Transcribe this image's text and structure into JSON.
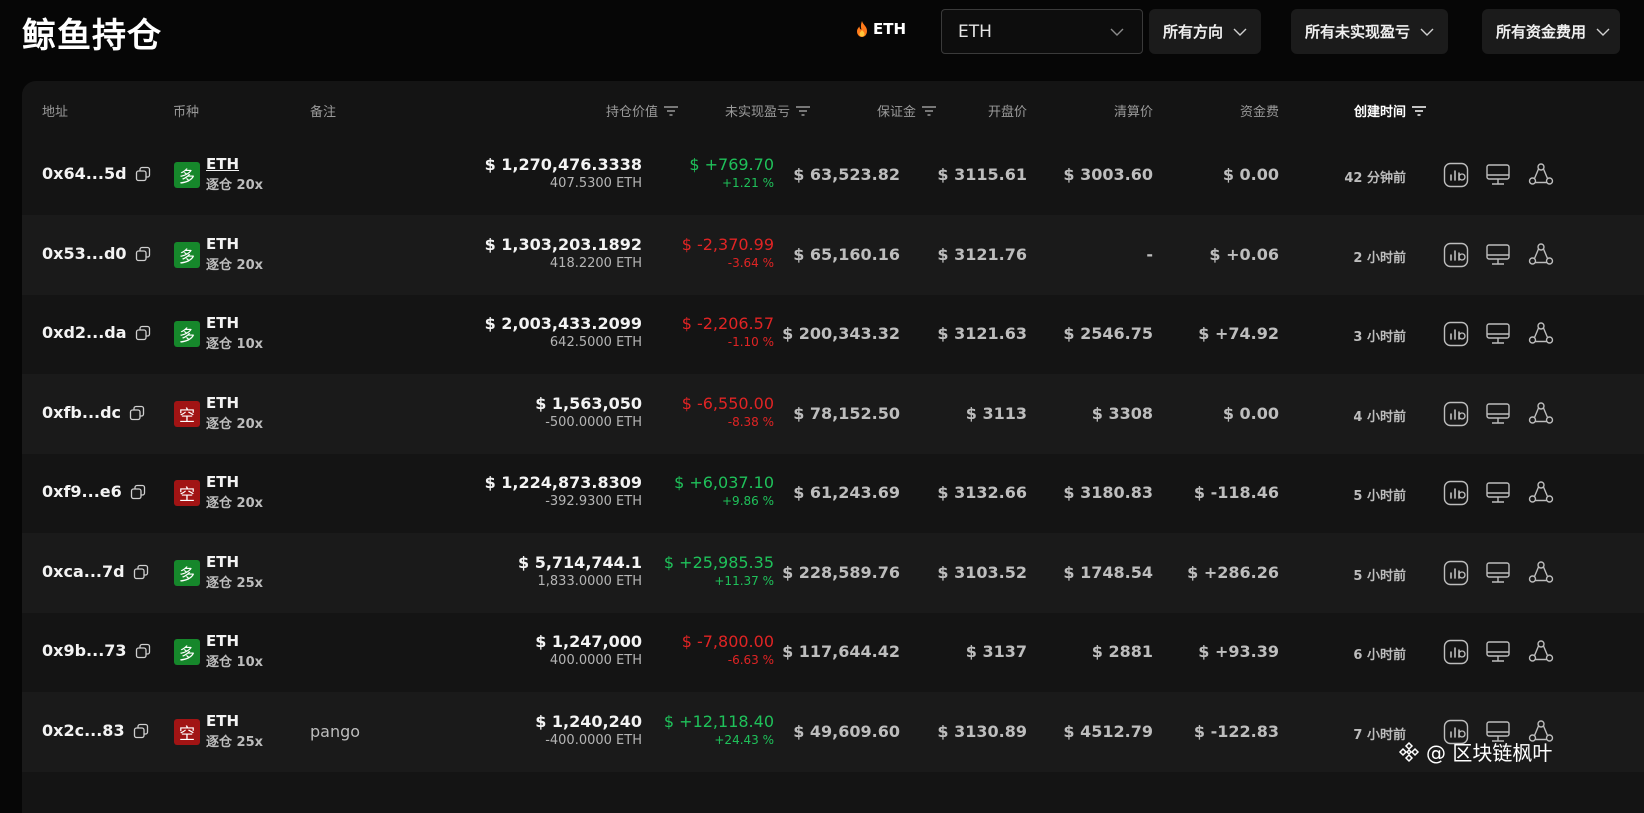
{
  "header": {
    "title": "鲸鱼持仓",
    "coin_tag": "ETH",
    "coin_select": "ETH",
    "filters": [
      "所有方向",
      "所有未实现盈亏",
      "所有资金费用"
    ]
  },
  "table": {
    "columns": {
      "address": "地址",
      "coin": "币种",
      "note": "备注",
      "value": "持仓价值",
      "pnl": "未实现盈亏",
      "margin": "保证金",
      "entry": "开盘价",
      "liq": "清算价",
      "funding": "资金费",
      "created": "创建时间"
    },
    "rows": [
      {
        "address": "0x64...5d",
        "side": "多",
        "side_type": "long",
        "coin": "ETH",
        "leverage": "逐仓 20x",
        "note": "",
        "value_usd": "$ 1,270,476.3338",
        "value_eth": "407.5300 ETH",
        "pnl": "$ +769.70",
        "pnl_pct": "+1.21 %",
        "pnl_sign": "pos",
        "margin": "$ 63,523.82",
        "entry": "$ 3115.61",
        "liq": "$ 3003.60",
        "funding": "$ 0.00",
        "funding_sign": "neutral",
        "created": "42 分钟前"
      },
      {
        "address": "0x53...d0",
        "side": "多",
        "side_type": "long",
        "coin": "ETH",
        "leverage": "逐仓 20x",
        "note": "",
        "value_usd": "$ 1,303,203.1892",
        "value_eth": "418.2200 ETH",
        "pnl": "$ -2,370.99",
        "pnl_pct": "-3.64 %",
        "pnl_sign": "neg",
        "margin": "$ 65,160.16",
        "entry": "$ 3121.76",
        "liq": "-",
        "funding": "$ +0.06",
        "funding_sign": "pos",
        "created": "2 小时前"
      },
      {
        "address": "0xd2...da",
        "side": "多",
        "side_type": "long",
        "coin": "ETH",
        "leverage": "逐仓 10x",
        "note": "",
        "value_usd": "$ 2,003,433.2099",
        "value_eth": "642.5000 ETH",
        "pnl": "$ -2,206.57",
        "pnl_pct": "-1.10 %",
        "pnl_sign": "neg",
        "margin": "$ 200,343.32",
        "entry": "$ 3121.63",
        "liq": "$ 2546.75",
        "funding": "$ +74.92",
        "funding_sign": "pos",
        "created": "3 小时前"
      },
      {
        "address": "0xfb...dc",
        "side": "空",
        "side_type": "short",
        "coin": "ETH",
        "leverage": "逐仓 20x",
        "note": "",
        "value_usd": "$ 1,563,050",
        "value_eth": "-500.0000 ETH",
        "pnl": "$ -6,550.00",
        "pnl_pct": "-8.38 %",
        "pnl_sign": "neg",
        "margin": "$ 78,152.50",
        "entry": "$ 3113",
        "liq": "$ 3308",
        "funding": "$ 0.00",
        "funding_sign": "neutral",
        "created": "4 小时前"
      },
      {
        "address": "0xf9...e6",
        "side": "空",
        "side_type": "short",
        "coin": "ETH",
        "leverage": "逐仓 20x",
        "note": "",
        "value_usd": "$ 1,224,873.8309",
        "value_eth": "-392.9300 ETH",
        "pnl": "$ +6,037.10",
        "pnl_pct": "+9.86 %",
        "pnl_sign": "pos",
        "margin": "$ 61,243.69",
        "entry": "$ 3132.66",
        "liq": "$ 3180.83",
        "funding": "$ -118.46",
        "funding_sign": "neg",
        "created": "5 小时前"
      },
      {
        "address": "0xca...7d",
        "side": "多",
        "side_type": "long",
        "coin": "ETH",
        "leverage": "逐仓 25x",
        "note": "",
        "value_usd": "$ 5,714,744.1",
        "value_eth": "1,833.0000 ETH",
        "pnl": "$ +25,985.35",
        "pnl_pct": "+11.37 %",
        "pnl_sign": "pos",
        "margin": "$ 228,589.76",
        "entry": "$ 3103.52",
        "liq": "$ 1748.54",
        "funding": "$ +286.26",
        "funding_sign": "pos",
        "created": "5 小时前"
      },
      {
        "address": "0x9b...73",
        "side": "多",
        "side_type": "long",
        "coin": "ETH",
        "leverage": "逐仓 10x",
        "note": "",
        "value_usd": "$ 1,247,000",
        "value_eth": "400.0000 ETH",
        "pnl": "$ -7,800.00",
        "pnl_pct": "-6.63 %",
        "pnl_sign": "neg",
        "margin": "$ 117,644.42",
        "entry": "$ 3137",
        "liq": "$ 2881",
        "funding": "$ +93.39",
        "funding_sign": "pos",
        "created": "6 小时前"
      },
      {
        "address": "0x2c...83",
        "side": "空",
        "side_type": "short",
        "coin": "ETH",
        "leverage": "逐仓 25x",
        "note": "pango",
        "value_usd": "$ 1,240,240",
        "value_eth": "-400.0000 ETH",
        "pnl": "$ +12,118.40",
        "pnl_pct": "+24.43 %",
        "pnl_sign": "pos",
        "margin": "$ 49,609.60",
        "entry": "$ 3130.89",
        "liq": "$ 4512.79",
        "funding": "$ -122.83",
        "funding_sign": "neg",
        "created": "7 小时前"
      }
    ]
  },
  "watermark": "@ 区块链枫叶",
  "icons": {
    "coin_tag": "fire-icon",
    "dropdown": "chevron-down-icon",
    "sort": "sort-icon",
    "copy": "copy-icon",
    "actions": [
      "chart-icon",
      "monitor-icon",
      "share-icon"
    ],
    "watermark": "binance-logo-icon"
  },
  "colors": {
    "positive": "#1fc15a",
    "negative": "#e02424",
    "long_badge": "#16872b",
    "short_badge": "#a11414",
    "background": "#060606",
    "panel": "#141414"
  }
}
